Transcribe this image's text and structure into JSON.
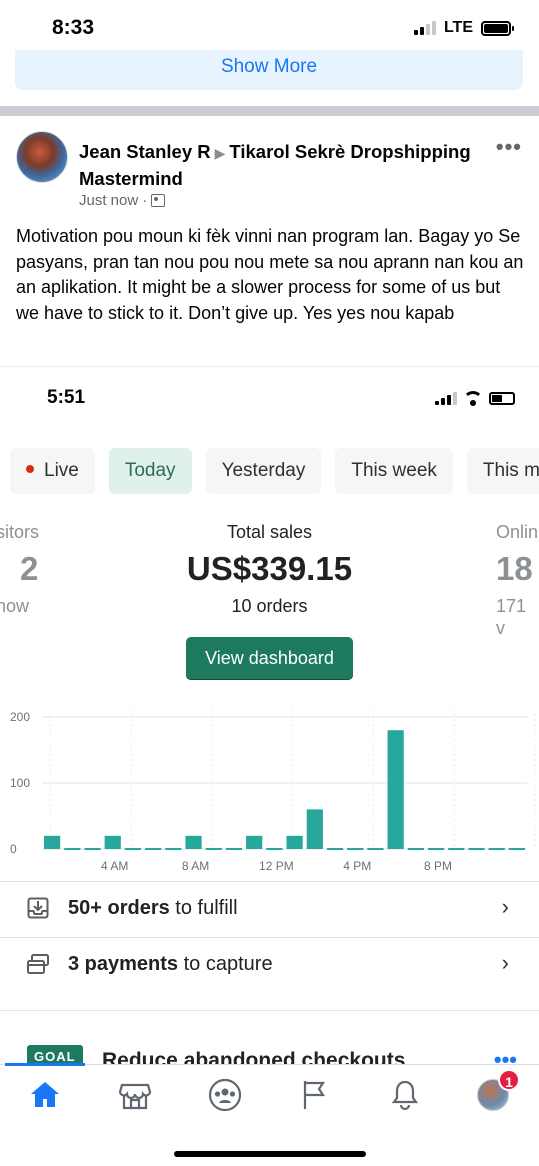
{
  "status_bar": {
    "time": "8:33",
    "network": "LTE"
  },
  "feed": {
    "show_more_label": "Show More"
  },
  "post": {
    "author": "Jean Stanley R",
    "group_name": "Tikarol Sekrè Dropshipping Mastermind",
    "timestamp": "Just now",
    "text": "Motivation pou moun ki fèk vinni nan program lan. Bagay yo Se pasyans, pran tan nou pou nou mete sa nou aprann nan kou an an aplikation. It might be a slower process for some of us but we have to stick to it. Don’t give up. Yes yes nou kapab"
  },
  "shared_screenshot": {
    "time": "5:51",
    "tabs": [
      {
        "label": "Live"
      },
      {
        "label": "Today"
      },
      {
        "label": "Yesterday"
      },
      {
        "label": "This week"
      },
      {
        "label": "This m"
      }
    ],
    "active_tab": "Today",
    "stats": {
      "left": {
        "label": "sitors",
        "value": "2",
        "sub": "now"
      },
      "center": {
        "label": "Total sales",
        "value": "US$339.15",
        "sub": "10 orders"
      },
      "right": {
        "label": "Onlin",
        "value": "18",
        "sub": "171 v"
      }
    },
    "view_dashboard_label": "View dashboard",
    "tasks": [
      {
        "bold": "50+ orders",
        "rest": " to fulfill"
      },
      {
        "bold": "3 payments",
        "rest": " to capture"
      }
    ],
    "goal": {
      "badge": "GOAL",
      "text": "Reduce abandoned checkouts"
    }
  },
  "chart_data": {
    "type": "bar",
    "categories": [
      "0",
      "1",
      "2",
      "3",
      "4",
      "5",
      "6",
      "7",
      "8",
      "9",
      "10",
      "11",
      "12",
      "13",
      "14",
      "15",
      "16",
      "17",
      "18",
      "19",
      "20",
      "21",
      "22",
      "23"
    ],
    "values": [
      20,
      0,
      0,
      20,
      0,
      0,
      0,
      20,
      0,
      0,
      20,
      0,
      20,
      60,
      0,
      0,
      0,
      180,
      0,
      0,
      0,
      0,
      0,
      0
    ],
    "x_tick_labels": [
      "4 AM",
      "8 AM",
      "12 PM",
      "4 PM",
      "8 PM"
    ],
    "y_tick_labels": [
      "0",
      "100",
      "200"
    ],
    "ylim": [
      0,
      200
    ],
    "bar_color": "#28a79c"
  },
  "bottom_nav": {
    "notification_count": "1",
    "accent": "#1877f2"
  }
}
